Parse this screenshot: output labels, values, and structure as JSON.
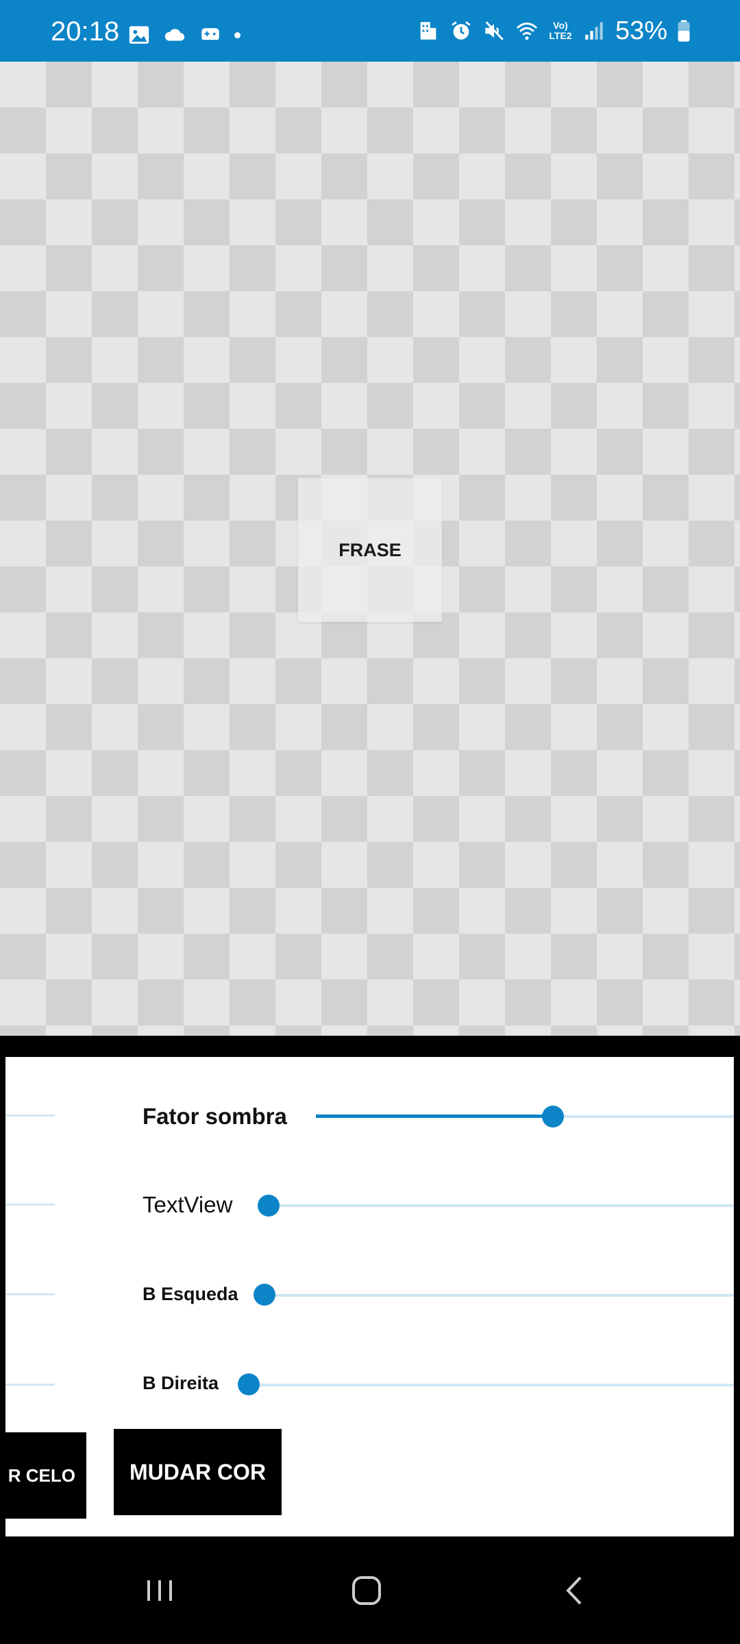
{
  "status_bar": {
    "time": "20:18",
    "battery": "53%",
    "network_label": "Vo) LTE2",
    "left_icons": [
      "image-icon",
      "cloud-icon",
      "game-icon",
      "dot-icon"
    ],
    "right_icons": [
      "building-icon",
      "alarm-icon",
      "mute-icon",
      "wifi-icon",
      "lte-icon",
      "signal-icon",
      "battery-icon"
    ],
    "background_color": "#0b84c8"
  },
  "canvas": {
    "frase_label": "FRASE"
  },
  "controls": {
    "sliders": [
      {
        "label": "Fator sombra",
        "value": 0.57
      },
      {
        "label": "TextView",
        "value": 0.0
      },
      {
        "label": "B Esqueda",
        "value": 0.0
      },
      {
        "label": "B Direita",
        "value": 0.0
      }
    ],
    "buttons": {
      "partial_left_label": "R CELO",
      "mudar_cor_label": "MUDAR COR"
    },
    "accent_color": "#0b84c8",
    "track_color": "#cfe7f4"
  },
  "nav_bar": {
    "icons": [
      "recent-apps-icon",
      "home-icon",
      "back-icon"
    ]
  }
}
